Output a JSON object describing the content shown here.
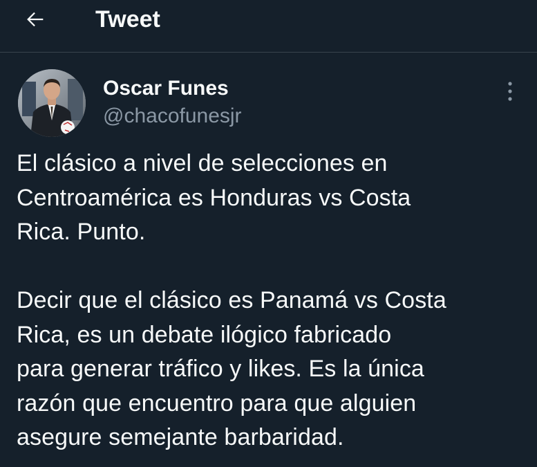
{
  "header": {
    "back_icon": "arrow-left-icon",
    "title": "Tweet"
  },
  "tweet": {
    "author": {
      "name": "Oscar Funes",
      "handle": "@chacofunesjr",
      "avatar_icon": "avatar"
    },
    "more_icon": "vertical-ellipsis-icon",
    "text": "El clásico a nivel de selecciones en\nCentroamérica es Honduras vs Costa\nRica. Punto.\n\nDecir que el clásico es Panamá vs Costa\nRica, es un debate ilógico fabricado\npara generar tráfico y likes. Es la única\nrazón que encuentro para que alguien\nasegure semejante barbaridad."
  },
  "colors": {
    "background": "#15202b",
    "divider": "#38444d",
    "primary_text": "#f7f9f9",
    "secondary_text": "#8b98a5"
  }
}
